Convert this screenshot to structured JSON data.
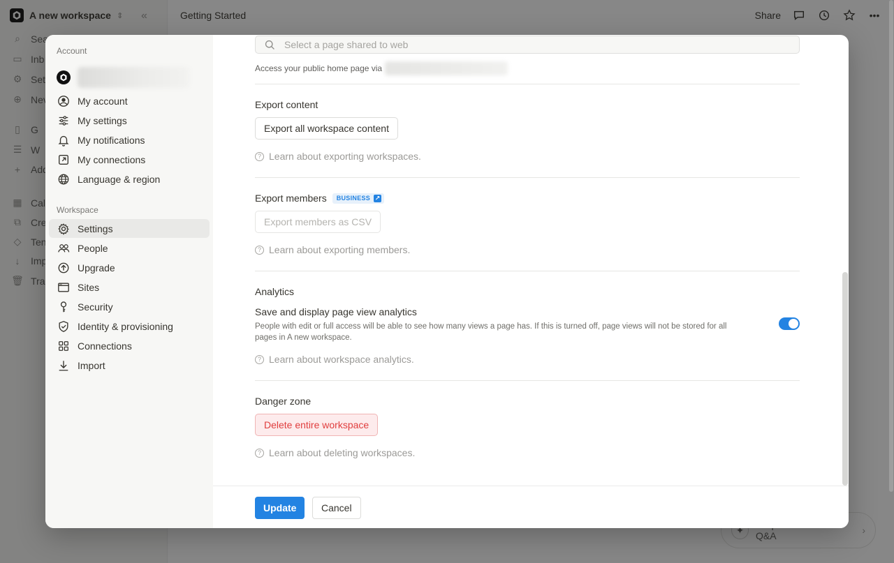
{
  "app": {
    "workspace_name": "A new workspace",
    "breadcrumb": "Getting Started",
    "topbar": {
      "share_label": "Share"
    },
    "sidebar_items": [
      {
        "label": "Sea",
        "icon": "search-icon"
      },
      {
        "label": "Inb",
        "icon": "inbox-icon"
      },
      {
        "label": "Set",
        "icon": "gear-icon"
      },
      {
        "label": "Nev",
        "icon": "plus-circle-icon"
      },
      {
        "label": "G",
        "icon": "page-icon"
      },
      {
        "label": "W",
        "icon": "list-icon"
      },
      {
        "label": "Add",
        "icon": "plus-icon"
      },
      {
        "label": "Cal",
        "icon": "calendar-icon"
      },
      {
        "label": "Cre",
        "icon": "create-icon"
      },
      {
        "label": "Ten",
        "icon": "templates-icon"
      },
      {
        "label": "Imp",
        "icon": "import-icon"
      },
      {
        "label": "Tra",
        "icon": "trash-icon"
      }
    ],
    "qa_pill": "Request access to Q&A"
  },
  "modal": {
    "sidebar": {
      "account_heading": "Account",
      "account_items": [
        {
          "label": "My account",
          "icon": "user-circle-icon"
        },
        {
          "label": "My settings",
          "icon": "sliders-icon"
        },
        {
          "label": "My notifications",
          "icon": "bell-icon"
        },
        {
          "label": "My connections",
          "icon": "external-link-icon"
        },
        {
          "label": "Language & region",
          "icon": "globe-icon"
        }
      ],
      "workspace_heading": "Workspace",
      "workspace_items": [
        {
          "label": "Settings",
          "icon": "gear-icon",
          "active": true
        },
        {
          "label": "People",
          "icon": "people-icon"
        },
        {
          "label": "Upgrade",
          "icon": "upgrade-arrow-icon"
        },
        {
          "label": "Sites",
          "icon": "browser-window-icon"
        },
        {
          "label": "Security",
          "icon": "key-icon"
        },
        {
          "label": "Identity & provisioning",
          "icon": "shield-check-icon"
        },
        {
          "label": "Connections",
          "icon": "grid-icon"
        },
        {
          "label": "Import",
          "icon": "download-icon"
        }
      ]
    },
    "main": {
      "public_home": {
        "search_placeholder": "Select a page shared to web",
        "note": "Access your public home page via"
      },
      "export_content": {
        "title": "Export content",
        "button": "Export all workspace content",
        "learn": "Learn about exporting workspaces."
      },
      "export_members": {
        "title": "Export members",
        "badge": "BUSINESS",
        "button": "Export members as CSV",
        "learn": "Learn about exporting members."
      },
      "analytics": {
        "title": "Analytics",
        "toggle_label": "Save and display page view analytics",
        "toggle_desc": "People with edit or full access will be able to see how many views a page has. If this is turned off, page views will not be stored for all pages in A new workspace.",
        "toggle_on": true,
        "learn": "Learn about workspace analytics."
      },
      "danger_zone": {
        "title": "Danger zone",
        "button": "Delete entire workspace",
        "learn": "Learn about deleting workspaces."
      }
    },
    "footer": {
      "update_label": "Update",
      "cancel_label": "Cancel"
    }
  },
  "colors": {
    "accent": "#2383e2",
    "danger": "#e03e3e",
    "sidebar_bg": "#f7f7f5"
  }
}
